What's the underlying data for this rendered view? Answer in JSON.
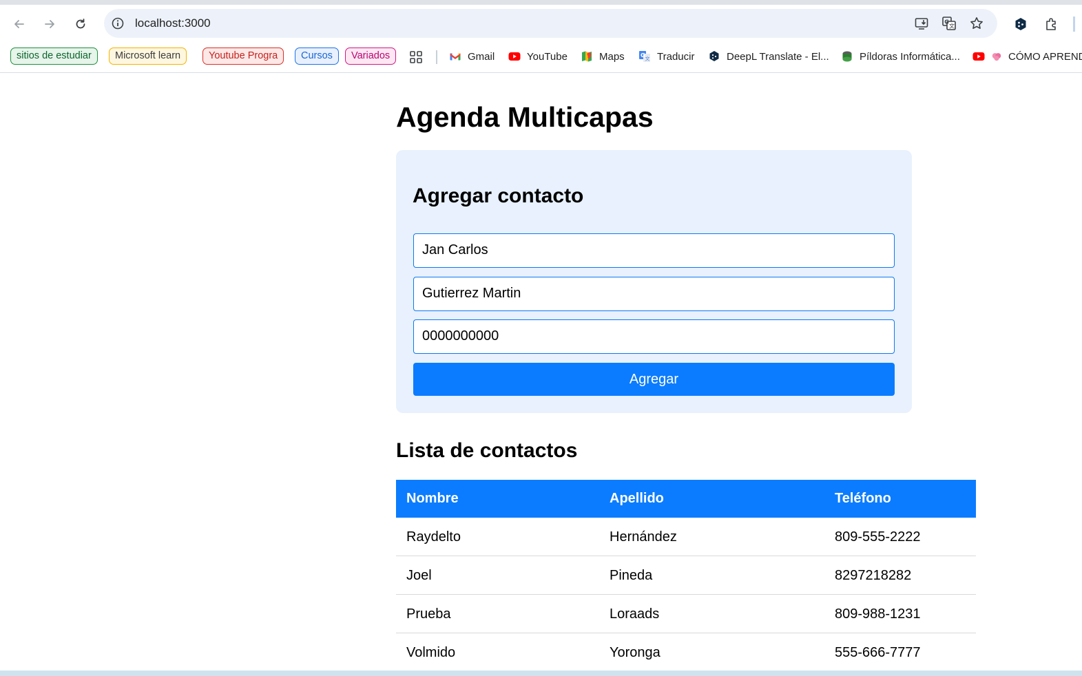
{
  "browser": {
    "url": "localhost:3000",
    "bookmarks": {
      "pills": [
        {
          "label": "sitios de estudiar",
          "color": "#1e8e3e",
          "bg": "#e6f4ea"
        },
        {
          "label": "Microsoft  learn",
          "color": "#e8a800",
          "bg": "#fef7e0"
        },
        {
          "label": "Youtube Progra",
          "color": "#d93025",
          "bg": "#fce8e6"
        },
        {
          "label": "Cursos",
          "color": "#1a73e8",
          "bg": "#e8f0fe"
        },
        {
          "label": "Variados",
          "color": "#c5148a",
          "bg": "#fde7f3"
        }
      ],
      "items": [
        {
          "label": "Gmail",
          "icon": "gmail-icon"
        },
        {
          "label": "YouTube",
          "icon": "youtube-icon"
        },
        {
          "label": "Maps",
          "icon": "maps-icon"
        },
        {
          "label": "Traducir",
          "icon": "translate-icon"
        },
        {
          "label": "DeepL Translate - El...",
          "icon": "deepl-icon"
        },
        {
          "label": "Píldoras Informática...",
          "icon": "pildoras-icon"
        },
        {
          "label": "CÓMO APREND",
          "icon": "brain-icon"
        }
      ]
    }
  },
  "app": {
    "title": "Agenda Multicapas",
    "form": {
      "heading": "Agregar contacto",
      "nombre_value": "Jan Carlos",
      "apellido_value": "Gutierrez Martin",
      "telefono_value": "0000000000",
      "submit_label": "Agregar"
    },
    "list": {
      "heading": "Lista de contactos",
      "columns": [
        "Nombre",
        "Apellido",
        "Teléfono"
      ],
      "rows": [
        [
          "Raydelto",
          "Hernández",
          "809-555-2222"
        ],
        [
          "Joel",
          "Pineda",
          "8297218282"
        ],
        [
          "Prueba",
          "Loraads",
          "809-988-1231"
        ],
        [
          "Volmido",
          "Yoronga",
          "555-666-7777"
        ]
      ]
    }
  },
  "colors": {
    "accent": "#0b7cff",
    "card_bg": "#e8f1fd"
  }
}
